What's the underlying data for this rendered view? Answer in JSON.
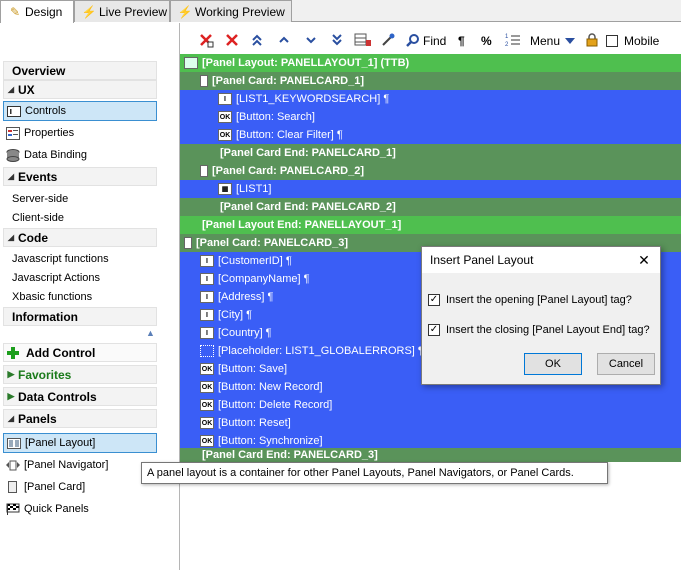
{
  "tabs": [
    {
      "label": "Design"
    },
    {
      "label": "Live Preview"
    },
    {
      "label": "Working Preview"
    }
  ],
  "toolbar": {
    "find_label": "Find",
    "pilcrow": "¶",
    "percent": "%",
    "menu_label": "Menu",
    "mobile_label": "Mobile"
  },
  "sidebar": {
    "overview": "Overview",
    "ux": "UX",
    "controls": "Controls",
    "properties": "Properties",
    "data_binding": "Data Binding",
    "events": "Events",
    "server_side": "Server-side",
    "client_side": "Client-side",
    "code": "Code",
    "js_functions": "Javascript functions",
    "js_actions": "Javascript Actions",
    "xbasic": "Xbasic functions",
    "information": "Information",
    "add_control": "Add Control",
    "favorites": "Favorites",
    "data_controls": "Data Controls",
    "panels": "Panels",
    "panel_layout": "[Panel Layout]",
    "panel_navigator": "[Panel Navigator]",
    "panel_card": "[Panel Card]",
    "quick_panels": "Quick Panels"
  },
  "tree": [
    {
      "text": "[Panel Layout: PANELLAYOUT_1] (TTB)"
    },
    {
      "text": "[Panel Card: PANELCARD_1]"
    },
    {
      "text": "[LIST1_KEYWORDSEARCH] ¶"
    },
    {
      "text": "[Button: Search]"
    },
    {
      "text": "[Button: Clear Filter] ¶"
    },
    {
      "text": "[Panel Card End: PANELCARD_1]"
    },
    {
      "text": "[Panel Card: PANELCARD_2]"
    },
    {
      "text": "[LIST1]"
    },
    {
      "text": "[Panel Card End: PANELCARD_2]"
    },
    {
      "text": "[Panel Layout End: PANELLAYOUT_1]"
    },
    {
      "text": "[Panel Card: PANELCARD_3]"
    },
    {
      "text": "[CustomerID] ¶"
    },
    {
      "text": "[CompanyName] ¶"
    },
    {
      "text": "[Address] ¶"
    },
    {
      "text": "[City] ¶"
    },
    {
      "text": "[Country] ¶"
    },
    {
      "text": "[Placeholder: LIST1_GLOBALERRORS] ¶"
    },
    {
      "text": "[Button: Save]"
    },
    {
      "text": "[Button: New Record]"
    },
    {
      "text": "[Button: Delete Record]"
    },
    {
      "text": "[Button: Reset]"
    },
    {
      "text": "[Button: Synchronize]"
    },
    {
      "text": "[Panel Card End: PANELCARD_3]"
    }
  ],
  "dialog": {
    "title": "Insert Panel Layout",
    "opt1": "Insert the opening [Panel Layout] tag?",
    "opt2": "Insert the closing [Panel Layout End] tag?",
    "ok": "OK",
    "cancel": "Cancel"
  },
  "tooltip": "A panel layout is a container for other Panel Layouts, Panel Navigators, or Panel Cards.",
  "colors": {
    "layout_row": "#4fbf4f",
    "card_row": "#5a935a",
    "control_row": "#3a5ef6"
  }
}
